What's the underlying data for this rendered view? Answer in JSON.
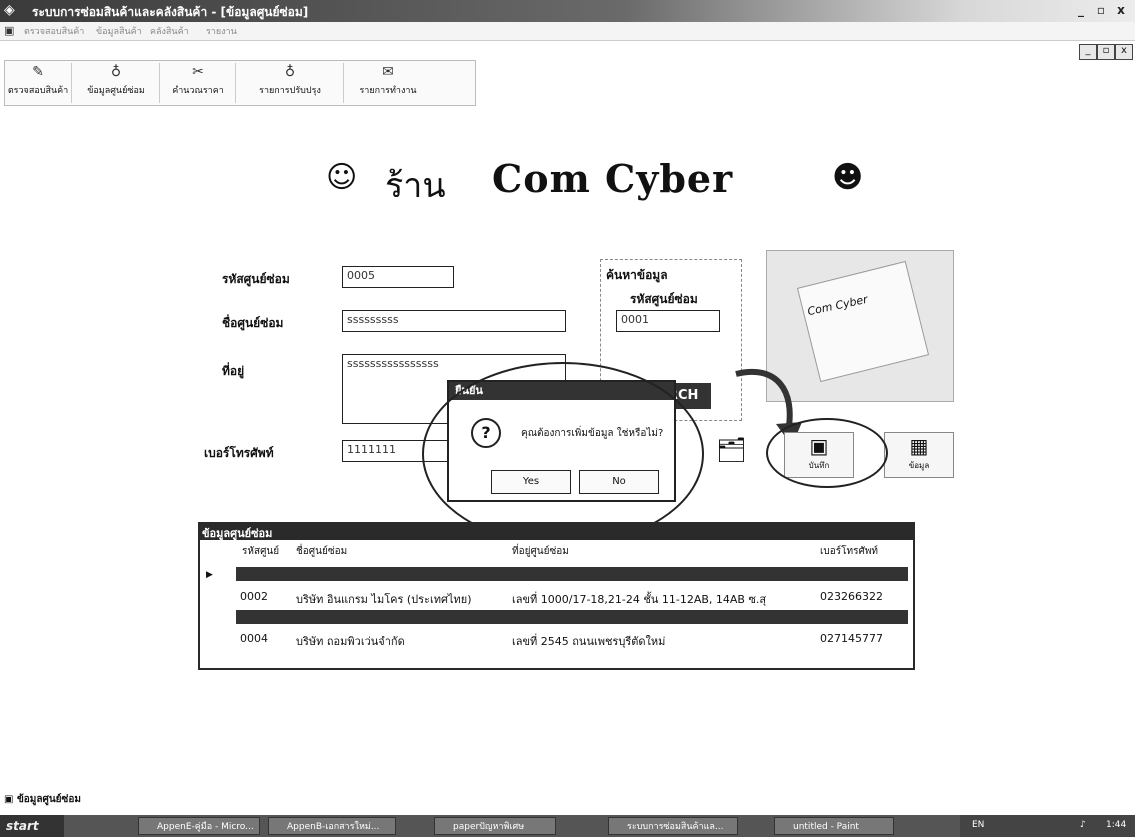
{
  "window": {
    "title": "ระบบการซ่อมสินค้าและคลังสินค้า - [ข้อมูลศูนย์ซ่อม]",
    "controls": [
      "_",
      "▫",
      "x"
    ],
    "mdi_controls": [
      "_",
      "▫",
      "x"
    ]
  },
  "menubar": {
    "items": [
      "ตรวจสอบสินค้า",
      "ข้อมูลสินค้า",
      "คลังสินค้า",
      "รายงาน"
    ]
  },
  "toolbar": {
    "items": [
      {
        "icon": "check-product-icon",
        "label": "ตรวจสอบสินค้า"
      },
      {
        "icon": "repair-center-icon",
        "label": "ข้อมูลศูนย์ซ่อม"
      },
      {
        "icon": "calculate-icon",
        "label": "คำนวณราคา"
      },
      {
        "icon": "update-list-icon",
        "label": "รายการปรับปรุง"
      },
      {
        "icon": "report-icon",
        "label": "รายการทำงาน"
      }
    ]
  },
  "banner": {
    "shop": "ร้าน",
    "name": "Com Cyber"
  },
  "form": {
    "code_label": "รหัสศูนย์ซ่อม",
    "code_value": "0005",
    "name_label": "ชื่อศูนย์ซ่อม",
    "name_value": "sssssssss",
    "address_label": "ที่อยู่",
    "address_value": "ssssssssssssssss",
    "phone_label": "เบอร์โทรศัพท์",
    "phone_value": "1111111"
  },
  "search": {
    "title": "ค้นหาข้อมูล",
    "label": "รหัสศูนย์ซ่อม",
    "value": "0001",
    "button": "SEARCH"
  },
  "actions": {
    "save_label": "บันทึก",
    "save_label_alt": "ข้อมูล"
  },
  "dialog": {
    "title": "ยืนยัน",
    "message": "คุณต้องการเพิ่มข้อมูล ใช่หรือไม่?",
    "yes": "Yes",
    "no": "No"
  },
  "grid": {
    "title": "ข้อมูลศูนย์ซ่อม",
    "headers": [
      "รหัสศูนย์",
      "ชื่อศูนย์ซ่อม",
      "ที่อยู่ศูนย์ซ่อม",
      "เบอร์โทรศัพท์"
    ],
    "rows": [
      [
        "0002",
        "บริษัท อินแกรม ไมโคร (ประเทศไทย)",
        "เลขที่ 1000/17-18,21-24 ชั้น 11-12AB, 14AB ซ.สุ",
        "023266322"
      ],
      [
        "0004",
        "บริษัท ถอมพิวเว่นจำกัด",
        "เลขที่ 2545 ถนนเพชรบุรีตัดใหม่",
        "027145777"
      ]
    ]
  },
  "footer": {
    "item": "ข้อมูลศูนย์ซ่อม"
  },
  "taskbar": {
    "start": "start",
    "tasks": [
      "AppenE-คู่มือ - Micro...",
      "AppenB-เอกสารใหม่...",
      "paperปัญหาพิเศษ",
      "ระบบการซ่อมสินค้าแล...",
      "untitled - Paint"
    ],
    "lang": "EN",
    "clock": "1:44"
  }
}
